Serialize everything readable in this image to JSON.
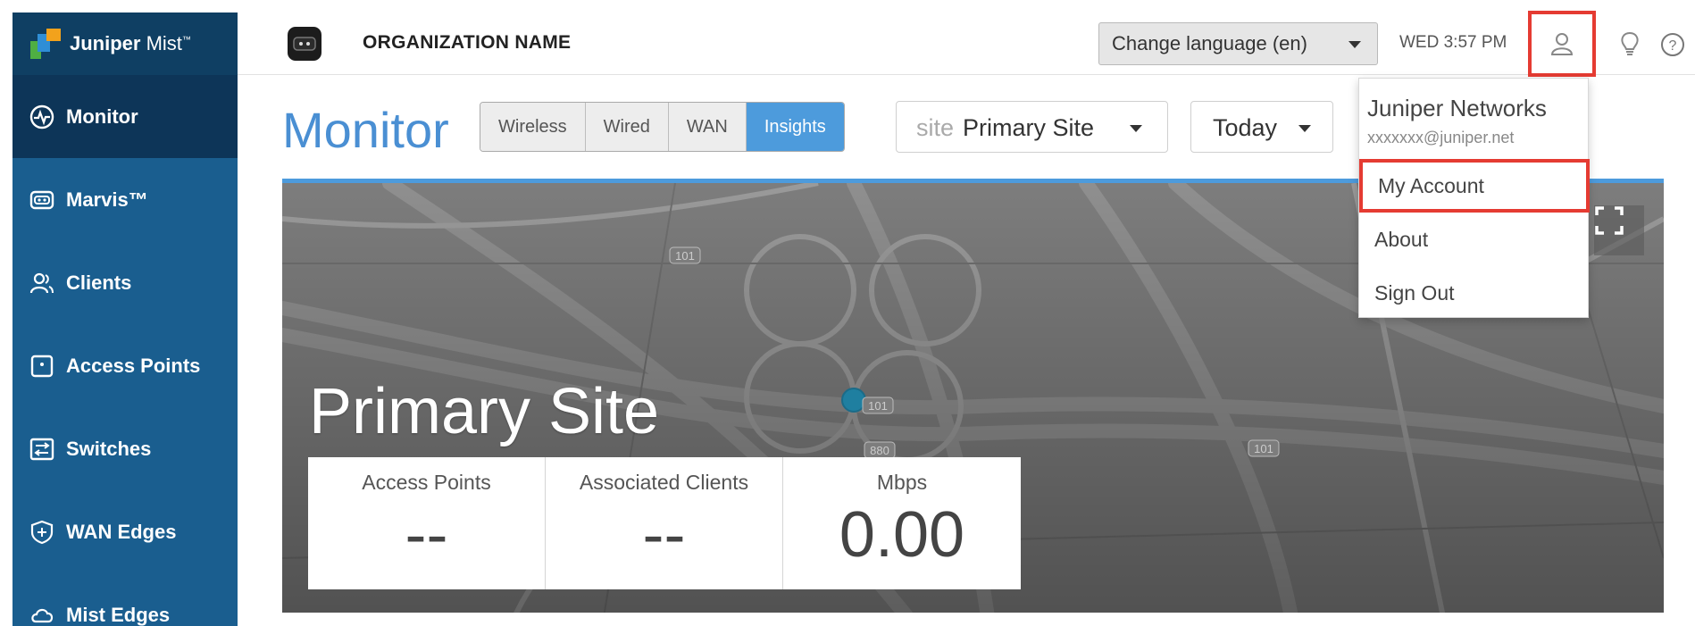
{
  "brand": {
    "name_bold": "Juniper",
    "name_light": "Mist",
    "tm": "™"
  },
  "sidebar": {
    "items": [
      {
        "label": "Monitor",
        "icon": "monitor-pulse-icon",
        "active": true
      },
      {
        "label": "Marvis™",
        "icon": "marvis-icon",
        "active": false
      },
      {
        "label": "Clients",
        "icon": "clients-icon",
        "active": false
      },
      {
        "label": "Access Points",
        "icon": "access-point-icon",
        "active": false
      },
      {
        "label": "Switches",
        "icon": "switch-icon",
        "active": false
      },
      {
        "label": "WAN Edges",
        "icon": "wan-edge-icon",
        "active": false
      },
      {
        "label": "Mist Edges",
        "icon": "cloud-icon",
        "active": false
      }
    ]
  },
  "topbar": {
    "org_name": "ORGANIZATION NAME",
    "language": "Change language (en)",
    "clock": "WED 3:57 PM",
    "icons": [
      "user-icon",
      "lightbulb-icon",
      "help-icon"
    ]
  },
  "monitor": {
    "title": "Monitor",
    "tabs": [
      {
        "label": "Wireless",
        "active": false
      },
      {
        "label": "Wired",
        "active": false
      },
      {
        "label": "WAN",
        "active": false
      },
      {
        "label": "Insights",
        "active": true
      }
    ],
    "site_prefix": "site",
    "site_value": "Primary Site",
    "date_value": "Today"
  },
  "map": {
    "site_name": "Primary Site",
    "road_labels": [
      "101",
      "101",
      "101",
      "880"
    ],
    "stats": [
      {
        "label": "Access Points",
        "value": "--"
      },
      {
        "label": "Associated Clients",
        "value": "--"
      },
      {
        "label": "Mbps",
        "value": "0.00"
      }
    ]
  },
  "account_menu": {
    "company": "Juniper Networks",
    "email": "xxxxxxx@juniper.net",
    "items": [
      "My Account",
      "About",
      "Sign Out"
    ]
  },
  "colors": {
    "sidebar": "#1a5e8f",
    "sidebar_active": "#0d3558",
    "accent": "#4d9bdc",
    "highlight": "#e53b32"
  }
}
